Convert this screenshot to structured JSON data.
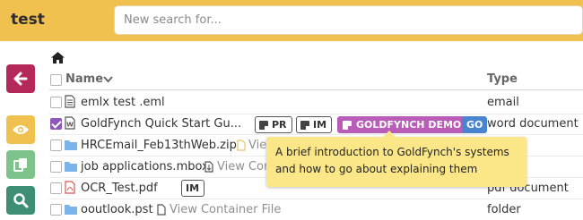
{
  "app": {
    "title": "test"
  },
  "search": {
    "placeholder": "New search for..."
  },
  "columns": {
    "name": "Name",
    "type": "Type"
  },
  "files": [
    {
      "name": "emlx test .eml",
      "type": "email",
      "icon": "document-icon",
      "checked": false
    },
    {
      "name": "GoldFynch Quick Start Gu...",
      "type": "word document",
      "icon": "word-icon",
      "checked": true,
      "tags": [
        "PR",
        "IM",
        "GOLDFYNCH DEMO",
        "GO"
      ]
    },
    {
      "name": "HRCEmail_Feb13thWeb.zip",
      "type": "",
      "icon": "folder-icon",
      "checked": false,
      "extra": "View C"
    },
    {
      "name": "job applications.mbox",
      "type": "",
      "icon": "folder-icon",
      "checked": false,
      "extra": "View Con"
    },
    {
      "name": "OCR_Test.pdf",
      "type": "pdf document",
      "icon": "pdf-icon",
      "checked": false,
      "tags": [
        "IM"
      ]
    },
    {
      "name": "ooutlook.pst",
      "type": "folder",
      "icon": "folder-icon",
      "checked": false,
      "extra": "View Container File"
    }
  ],
  "tooltip": {
    "text": "A brief introduction to GoldFynch's systems and how to go about explaining them"
  },
  "colors": {
    "topbar": "#f0c14e",
    "back_button": "#b5285c",
    "view_button": "#f0c14e",
    "copy_button": "#7ec38c",
    "search_button": "#3c8f74",
    "goldfynch_tag": "#b95db8",
    "go_tag": "#4a84cf",
    "tooltip": "#fce788",
    "folder": "#7ab4ea"
  }
}
